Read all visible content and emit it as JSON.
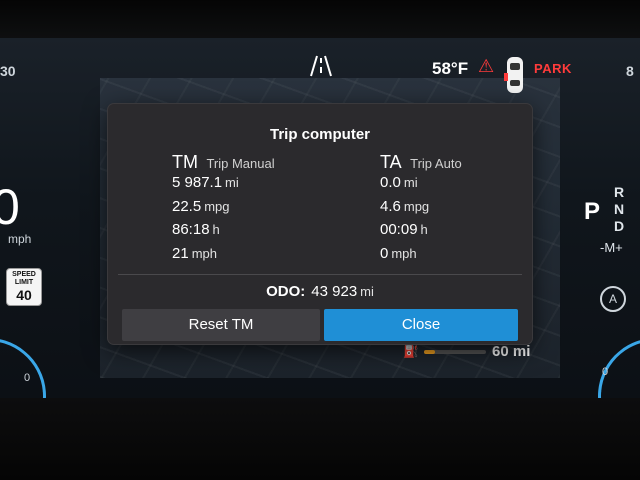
{
  "status_bar": {
    "left_edge_text": "30",
    "right_edge_text": "8",
    "temperature": "58°F",
    "park_label": "PARK"
  },
  "left_gauge": {
    "speed_value": "0",
    "speed_unit": "mph",
    "speed_limit_line1": "SPEED",
    "speed_limit_line2": "LIMIT",
    "speed_limit_value": "40",
    "scale_zero": "0"
  },
  "right_gauge": {
    "gear_selected": "P",
    "gear_options": [
      "R",
      "N",
      "D"
    ],
    "manual_mode": "-M+",
    "scale_zero": "0"
  },
  "range": {
    "value": "60",
    "unit": "mi",
    "fuel_level": 0.18
  },
  "trip_dialog": {
    "title": "Trip computer",
    "trip_manual": {
      "code": "TM",
      "name": "Trip Manual",
      "distance": "5 987.1",
      "distance_unit": "mi",
      "consumption": "22.5",
      "consumption_unit": "mpg",
      "time": "86:18",
      "time_unit": "h",
      "avg_speed": "21",
      "avg_speed_unit": "mph"
    },
    "trip_auto": {
      "code": "TA",
      "name": "Trip Auto",
      "distance": "0.0",
      "distance_unit": "mi",
      "consumption": "4.6",
      "consumption_unit": "mpg",
      "time": "00:09",
      "time_unit": "h",
      "avg_speed": "0",
      "avg_speed_unit": "mph"
    },
    "odo_label": "ODO:",
    "odo_value": "43 923",
    "odo_unit": "mi",
    "reset_button": "Reset TM",
    "close_button": "Close"
  },
  "colors": {
    "accent_blue": "#1f8fd6",
    "warning_red": "#ff3b3b",
    "fuel_orange": "#f0a020"
  },
  "icons": [
    "road-lanes-icon",
    "seatbelt-warning-icon",
    "car-door-icon",
    "fuel-pump-icon",
    "auto-hold-icon"
  ]
}
